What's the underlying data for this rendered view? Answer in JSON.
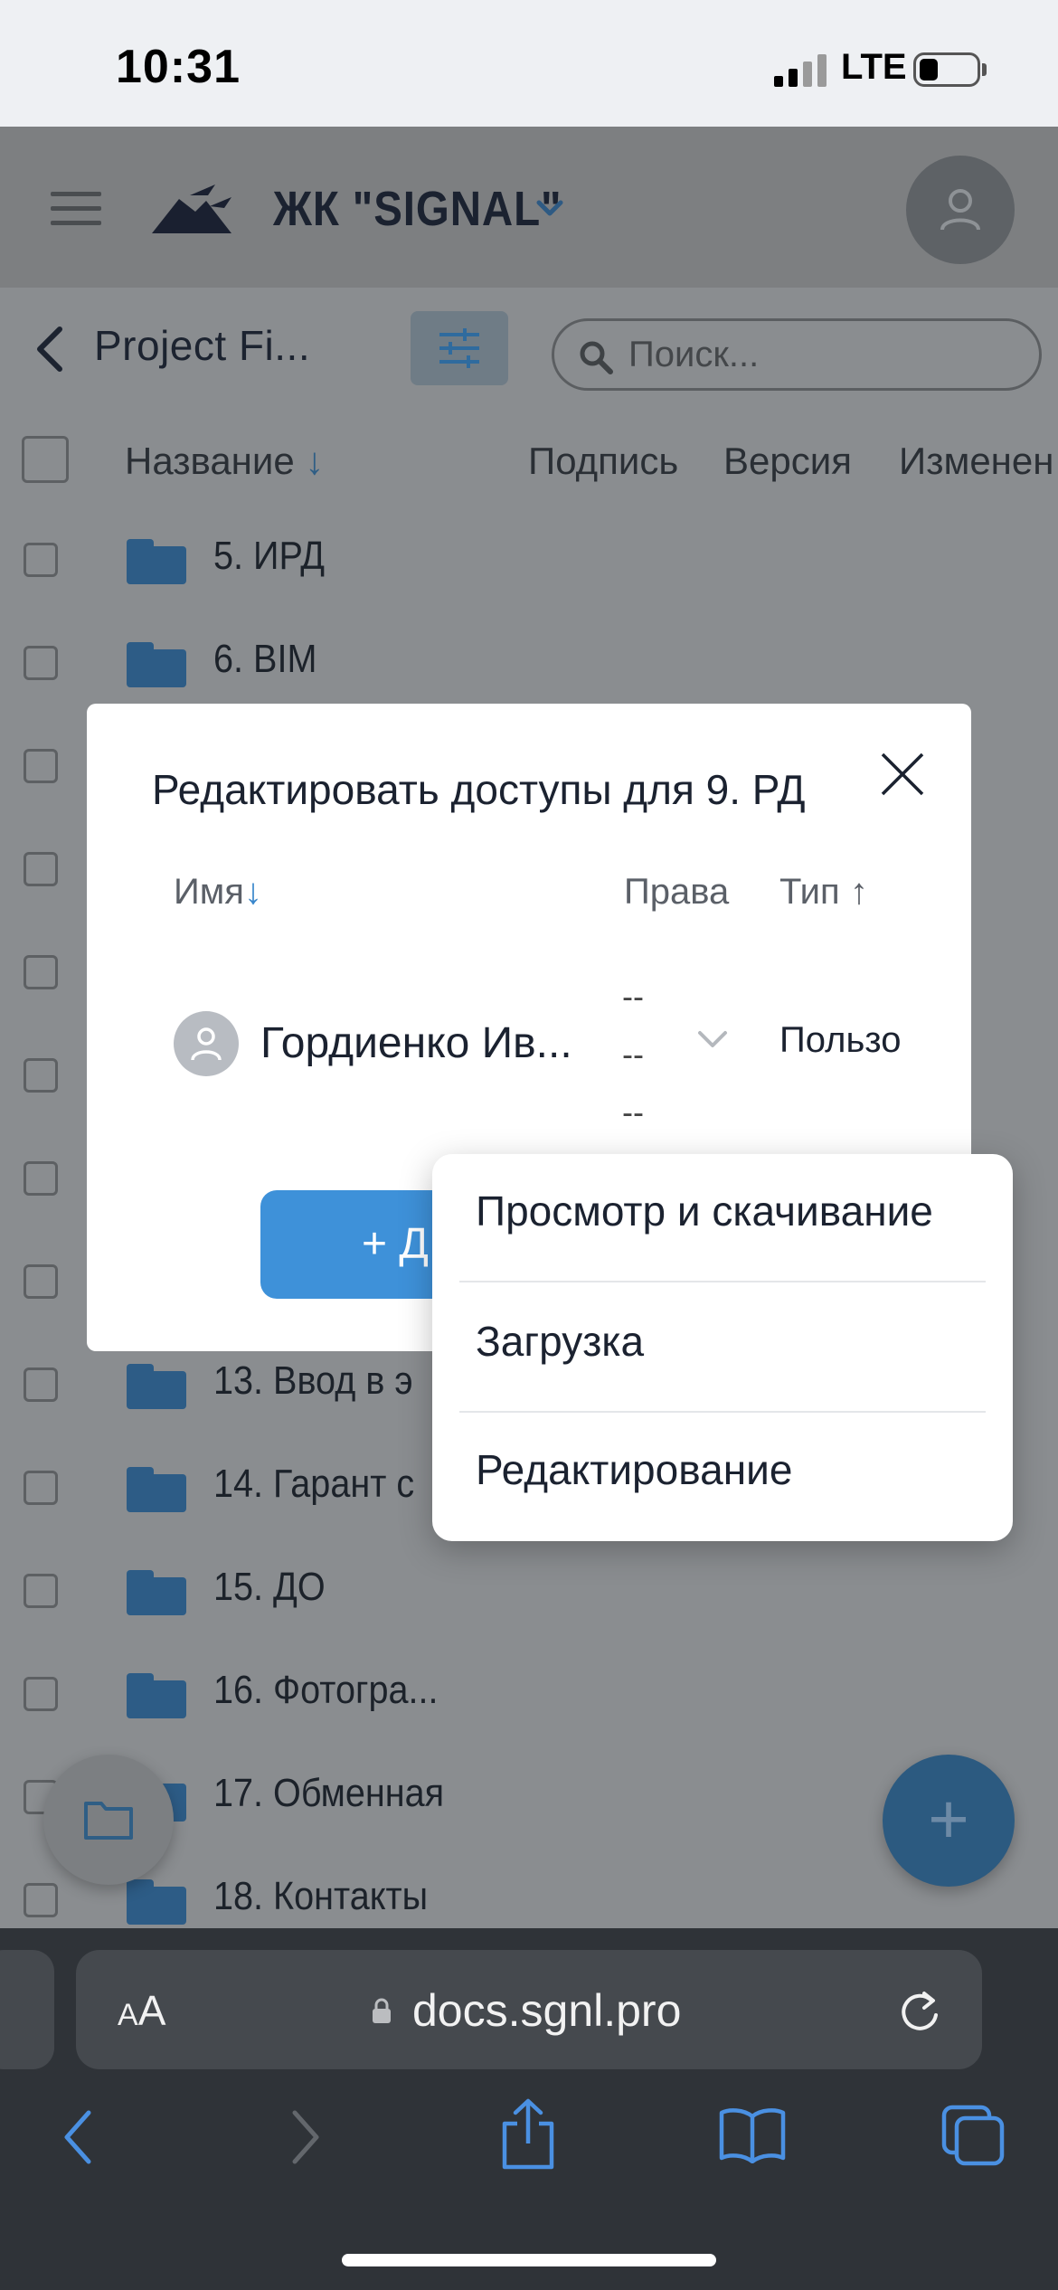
{
  "status_bar": {
    "time": "10:31",
    "network": "LTE"
  },
  "header": {
    "project_name": "ЖК \"SIGNAL\""
  },
  "toolbar": {
    "breadcrumb": "Project Fi...",
    "search_placeholder": "Поиск..."
  },
  "table": {
    "columns": {
      "name": "Название",
      "name_sort": "↓",
      "signature": "Подпись",
      "version": "Версия",
      "modified": "Изменен"
    },
    "rows": [
      "5. ИРД",
      "6. BIM",
      "13. Ввод в э",
      "14. Гарант с",
      "15. ДО",
      "16. Фотогра...",
      "17. Обменная",
      "18. Контакты"
    ]
  },
  "modal": {
    "title": "Редактировать доступы для 9. РД",
    "columns": {
      "name": "Имя",
      "name_sort": "↓",
      "rights": "Права",
      "type": "Тип",
      "type_sort": "↑"
    },
    "user": {
      "name": "Гордиенко Ив...",
      "rights_lines": [
        "--",
        "--",
        "--"
      ],
      "type": "Пользо"
    },
    "add_button": "+ Д"
  },
  "dropdown": {
    "options": [
      "Просмотр и скачивание",
      "Загрузка",
      "Редактирование"
    ]
  },
  "browser": {
    "text_size_small": "A",
    "text_size_large": "A",
    "url": "docs.sgnl.pro"
  },
  "fab": {
    "add": "+"
  },
  "icons": [
    "menu-icon",
    "logo-icon",
    "chevron-down-icon",
    "user-icon",
    "back-icon",
    "filter-icon",
    "search-icon",
    "folder-icon",
    "close-icon",
    "lock-icon",
    "reload-icon",
    "share-icon",
    "bookmarks-icon",
    "tabs-icon"
  ],
  "colors": {
    "accent": "#3e91d9",
    "folder": "#2d5c86",
    "overlay_bg": "#8a8d90"
  }
}
